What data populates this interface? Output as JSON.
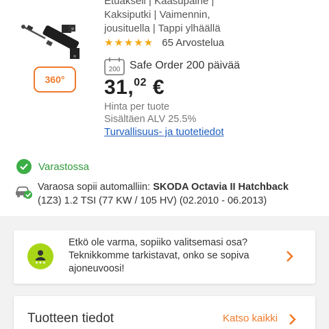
{
  "product": {
    "title_lines": [
      "Etuakseli | Kaasupaine |",
      "Kaksiputki | Vaimennin,",
      "jousituella | Tappi ylhäällä"
    ],
    "rating_stars": "★★★★★",
    "rating_value": 5,
    "reviews": "65 Arvostelua",
    "view_360_label": "360°",
    "safe_order_badge": "200",
    "safe_order": "Safe Order 200 päivää",
    "price_main": "31,",
    "price_cents": "02",
    "price_currency": " €",
    "price_note": "Hinta per tuote",
    "vat_note": "Sisältäen ALV 25.5%",
    "safety_link": "Turvallisuus- ja tuotetiedot"
  },
  "stock": {
    "label": "Varastossa"
  },
  "fits": {
    "prefix": "Varaosa sopii automalliin: ",
    "vehicle": "SKODA Octavia II Hatchback",
    "details": "(1Z3) 1.2 TSI (77 KW / 105 HV) (02.2010 - 06.2013)"
  },
  "help": {
    "text": "Etkö ole varma, sopiiko valitsemasi osa? Teknikkomme tarkistavat, onko se sopiva ajoneuvoosi!"
  },
  "product_info": {
    "title": "Tuotteen tiedot",
    "see_all": "Katso kaikki"
  },
  "colors": {
    "accent": "#f07a2a",
    "star": "#f2a818",
    "stock_green": "#3cae46",
    "link_blue": "#1f5fbf",
    "badge_green": "#a8d617"
  }
}
